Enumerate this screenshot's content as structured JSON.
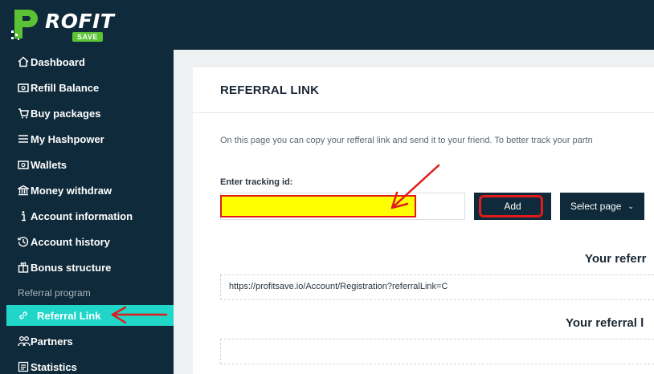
{
  "brand": {
    "word": "ROFIT",
    "badge": "SAVE",
    "accent": "#5bc236"
  },
  "sidebar": {
    "items": [
      {
        "label": "Dashboard",
        "icon": "home-icon"
      },
      {
        "label": "Refill Balance",
        "icon": "wallet-icon"
      },
      {
        "label": "Buy packages",
        "icon": "cart-icon"
      },
      {
        "label": "My Hashpower",
        "icon": "list-icon"
      },
      {
        "label": "Wallets",
        "icon": "wallet-icon"
      },
      {
        "label": "Money withdraw",
        "icon": "bank-icon"
      },
      {
        "label": "Account information",
        "icon": "info-icon"
      },
      {
        "label": "Account history",
        "icon": "history-icon"
      },
      {
        "label": "Bonus structure",
        "icon": "gift-icon"
      }
    ],
    "section_label": "Referral program",
    "referral_items": [
      {
        "label": "Referral Link",
        "icon": "link-icon",
        "active": true
      },
      {
        "label": "Partners",
        "icon": "partners-icon"
      },
      {
        "label": "Statistics",
        "icon": "statistics-icon"
      }
    ],
    "bg_color": "#0f2a3a",
    "active_color": "#1fd6c9"
  },
  "main": {
    "title": "REFERRAL LINK",
    "description": "On this page you can copy your refferal link and send it to your friend. To better track your partn",
    "tracking_label": "Enter tracking id:",
    "tracking_value": "",
    "add_label": "Add",
    "select_label": "Select page",
    "referral_heading_1": "Your referr",
    "referral_url": "https://profitsave.io/Account/Registration?referralLink=C",
    "referral_heading_2": "Your referral l"
  },
  "annotation_color": "#e01b1b",
  "highlight_color": "#ffff00"
}
